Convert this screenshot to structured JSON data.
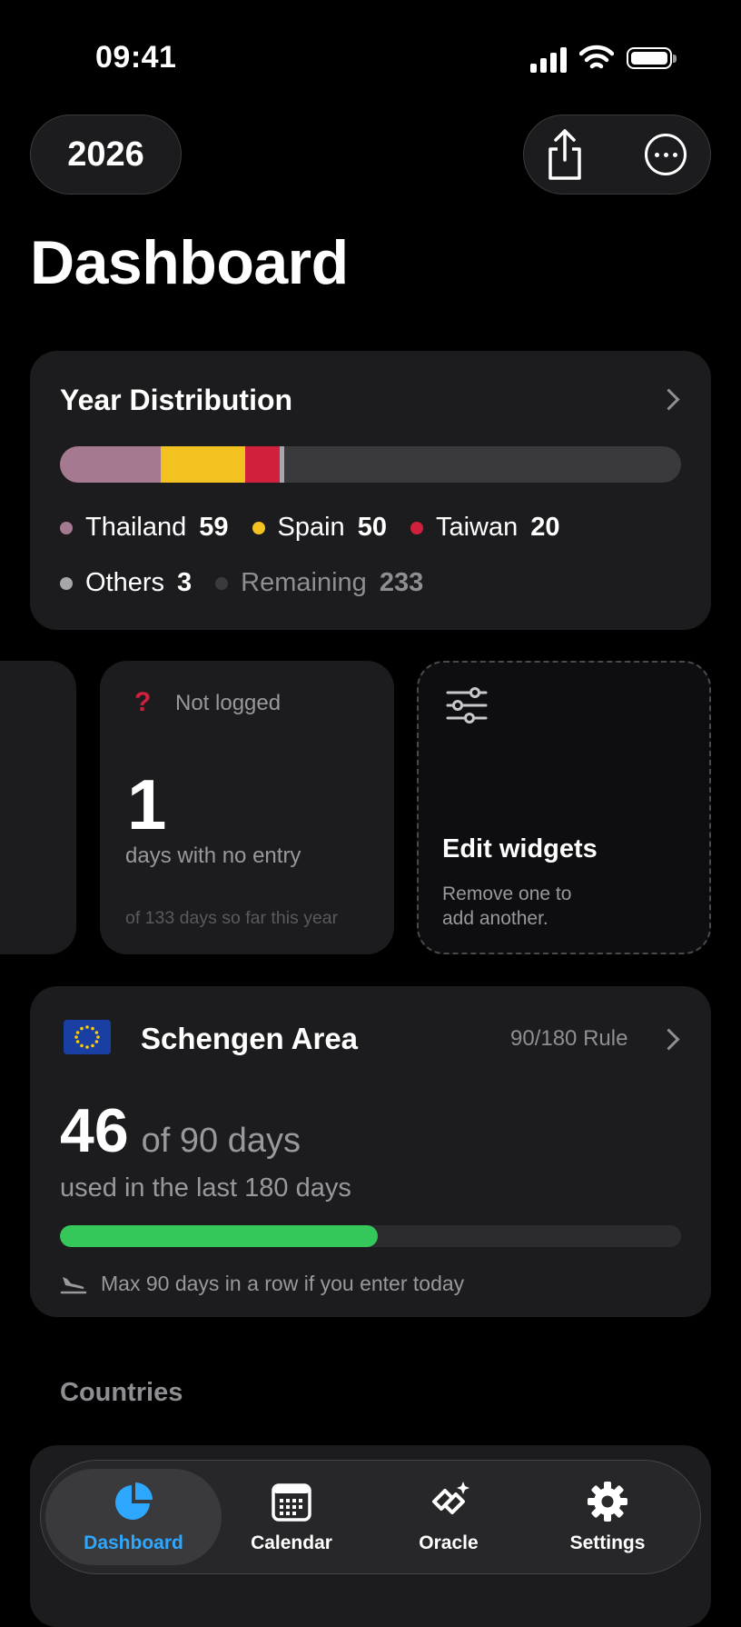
{
  "status_bar": {
    "time": "09:41"
  },
  "header": {
    "year": "2026",
    "title": "Dashboard"
  },
  "year_distribution": {
    "title": "Year Distribution",
    "segments": [
      {
        "name": "Thailand",
        "days": 59,
        "color": "#a5798f"
      },
      {
        "name": "Spain",
        "days": 50,
        "color": "#f2c320"
      },
      {
        "name": "Taiwan",
        "days": 20,
        "color": "#d0203c"
      },
      {
        "name": "Others",
        "days": 3,
        "color": "#a7a7ab"
      }
    ],
    "remaining": {
      "name": "Remaining",
      "days": 233,
      "color": "#3a3a3c"
    },
    "legend": {
      "thailand_name": "Thailand",
      "thailand_days": "59",
      "spain_name": "Spain",
      "spain_days": "50",
      "taiwan_name": "Taiwan",
      "taiwan_days": "20",
      "others_name": "Others",
      "others_days": "3",
      "remaining_name": "Remaining",
      "remaining_days": "233"
    }
  },
  "not_logged_widget": {
    "icon": "question-mark-icon",
    "label": "Not logged",
    "value": "1",
    "subtitle": "days with no entry",
    "footnote": "of 133 days so far this year"
  },
  "edit_widget": {
    "icon": "sliders-icon",
    "title": "Edit widgets",
    "subtitle_line1": "Remove one to",
    "subtitle_line2": "add another."
  },
  "schengen": {
    "flag": "eu-flag-icon",
    "title": "Schengen Area",
    "rule": "90/180 Rule",
    "used": "46",
    "of_total": "of 90 days",
    "period": "used in the last 180 days",
    "progress_fraction": 0.511,
    "note_icon": "airplane-landing-icon",
    "note": "Max 90 days in a row if you enter today"
  },
  "countries": {
    "label": "Countries"
  },
  "tab_bar": {
    "tabs": [
      {
        "label": "Dashboard",
        "icon": "pie-chart-icon",
        "active": true
      },
      {
        "label": "Calendar",
        "icon": "calendar-icon",
        "active": false
      },
      {
        "label": "Oracle",
        "icon": "oracle-sparkle-icon",
        "active": false
      },
      {
        "label": "Settings",
        "icon": "gear-icon",
        "active": false
      }
    ]
  },
  "colors": {
    "accent": "#2ea8ff",
    "progress": "#34c759",
    "card": "#1c1c1e"
  }
}
